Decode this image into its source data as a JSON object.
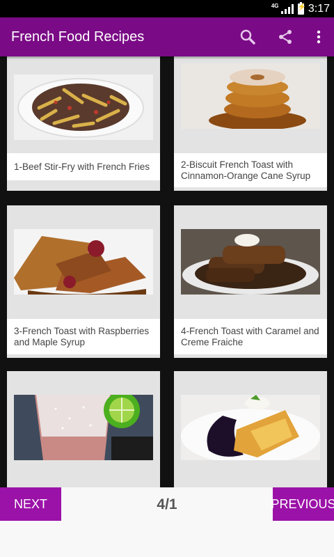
{
  "status_bar": {
    "network": "4G",
    "time": "3:17"
  },
  "app_bar": {
    "title": "French Food Recipes",
    "icons": [
      "search-icon",
      "share-icon",
      "overflow-menu-icon"
    ]
  },
  "recipes": [
    {
      "caption": "1-Beef Stir-Fry with French Fries"
    },
    {
      "caption": "2-Biscuit French Toast with Cinnamon-Orange Cane Syrup"
    },
    {
      "caption": "3-French Toast with Raspberries and Maple Syrup"
    },
    {
      "caption": "4-French Toast with Caramel and Creme Fraiche"
    },
    {
      "caption": ""
    },
    {
      "caption": ""
    }
  ],
  "pager": {
    "next_label": "NEXT",
    "previous_label": "PREVIOUS",
    "page_indicator": "4/1"
  },
  "colors": {
    "app_bar": "#7a0a86",
    "buttons": "#9b12a8",
    "card_bg": "#e3e3e3",
    "grid_bg": "#111111"
  }
}
